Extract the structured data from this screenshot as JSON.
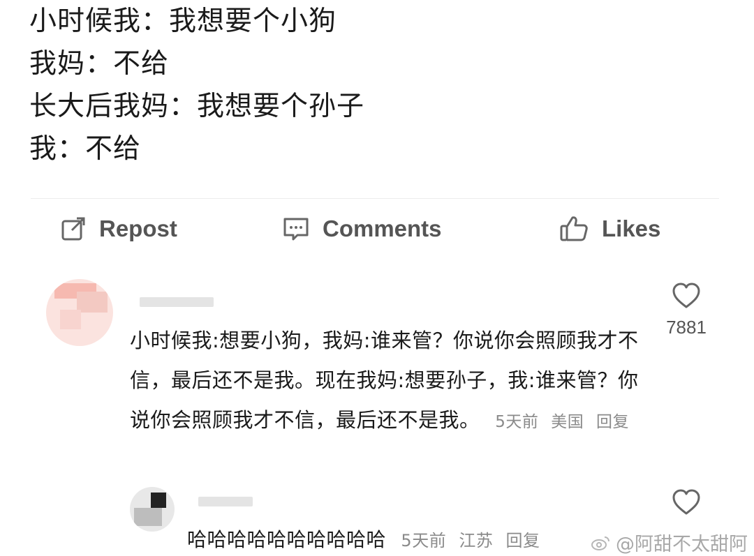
{
  "post": {
    "lines": [
      "小时候我：我想要个小狗",
      "我妈：不给",
      "长大后我妈：我想要个孙子",
      "我：不给"
    ]
  },
  "actions": {
    "repost": {
      "label": "Repost",
      "icon": "share-edit-icon"
    },
    "comments": {
      "label": "Comments",
      "icon": "comment-bubble-icon"
    },
    "likes": {
      "label": "Likes",
      "icon": "thumbs-up-icon"
    }
  },
  "comments": [
    {
      "text": "小时候我:想要小狗，我妈:谁来管？你说你会照顾我才不信，最后还不是我。现在我妈:想要孙子，我:谁来管？你说你会照顾我才不信，最后还不是我。",
      "time": "5天前",
      "location": "美国",
      "reply_label": "回复",
      "likes": "7881",
      "like_icon": "heart-icon"
    },
    {
      "text": "哈哈哈哈哈哈哈哈哈哈",
      "time": "5天前",
      "location": "江苏",
      "reply_label": "回复",
      "like_icon": "heart-icon"
    }
  ],
  "watermark": {
    "text": "@阿甜不太甜阿",
    "icon": "weibo-logo-icon"
  },
  "colors": {
    "text": "#1a1a1a",
    "muted": "#8a8a8a",
    "action": "#555555"
  }
}
